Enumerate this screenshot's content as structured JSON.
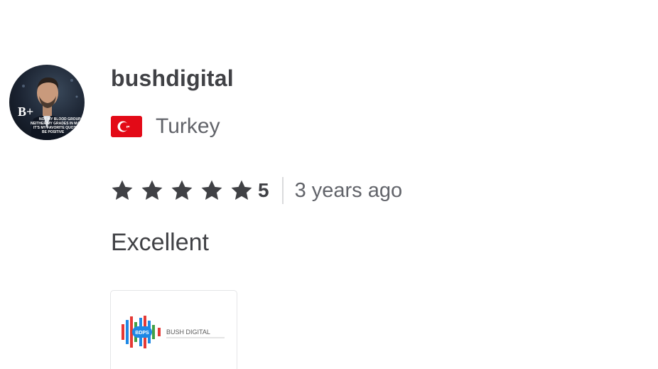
{
  "reviewer": {
    "username": "bushdigital",
    "avatar_badge_text": "B+",
    "avatar_caption": "NOT MY BLOOD GROUP NEITHER MY GRADES IN MATH IT'S MY FAVORITE QUOTE BE POSITIVE",
    "country": "Turkey",
    "flag_icon": "turkey-flag-icon",
    "flag_color": "#E30A17"
  },
  "rating": {
    "stars": 5,
    "max_stars": 5,
    "star_icon": "star-icon",
    "value_label": "5",
    "time_ago": "3 years ago"
  },
  "review": {
    "text": "Excellent"
  },
  "attachment": {
    "logo_monogram": "BDPS",
    "logo_text": "BUSH DIGITAL",
    "logo_colors": [
      "#E53935",
      "#1E88E5",
      "#43A047"
    ]
  },
  "colors": {
    "text_primary": "#404145",
    "text_secondary": "#62646A",
    "divider": "#DADBDD"
  }
}
